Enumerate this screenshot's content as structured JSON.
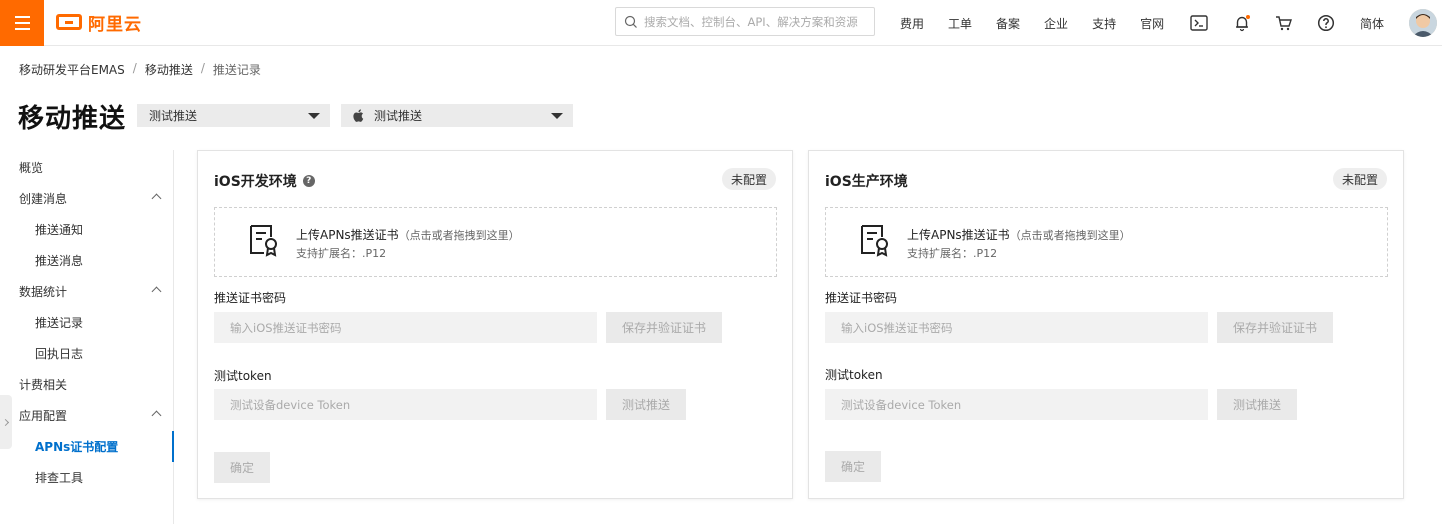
{
  "header": {
    "logo_text": "阿里云",
    "search_placeholder": "搜索文档、控制台、API、解决方案和资源",
    "nav": [
      "费用",
      "工单",
      "备案",
      "企业",
      "支持",
      "官网"
    ],
    "lang": "简体"
  },
  "breadcrumb": [
    "移动研发平台EMAS",
    "移动推送",
    "推送记录"
  ],
  "page_title": "移动推送",
  "selects": {
    "app": "测试推送",
    "platform": "测试推送"
  },
  "sidebar": {
    "items": [
      "概览",
      "创建消息",
      "推送通知",
      "推送消息",
      "数据统计",
      "推送记录",
      "回执日志",
      "计费相关",
      "应用配置",
      "APNs证书配置",
      "排查工具"
    ]
  },
  "cards": [
    {
      "title": "iOS开发环境",
      "status": "未配置",
      "upload_title": "上传APNs推送证书",
      "upload_hint": "（点击或者拖拽到这里）",
      "upload_sub": "支持扩展名：.P12",
      "password_label": "推送证书密码",
      "password_placeholder": "输入iOS推送证书密码",
      "verify_button": "保存并验证证书",
      "token_label": "测试token",
      "token_placeholder": "测试设备device Token",
      "test_button": "测试推送",
      "confirm_button": "确定"
    },
    {
      "title": "iOS生产环境",
      "status": "未配置",
      "upload_title": "上传APNs推送证书",
      "upload_hint": "（点击或者拖拽到这里）",
      "upload_sub": "支持扩展名：.P12",
      "password_label": "推送证书密码",
      "password_placeholder": "输入iOS推送证书密码",
      "verify_button": "保存并验证证书",
      "token_label": "测试token",
      "token_placeholder": "测试设备device Token",
      "test_button": "测试推送",
      "confirm_button": "确定"
    }
  ],
  "colors": {
    "brand": "#ff6a00",
    "active": "#0070cc"
  }
}
